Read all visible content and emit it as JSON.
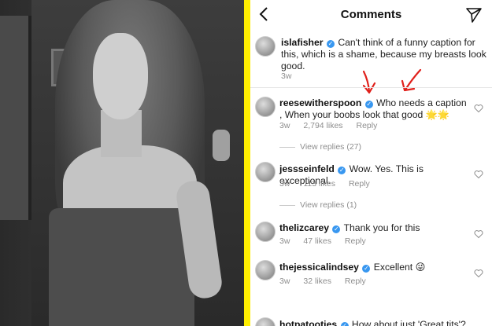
{
  "header": {
    "title": "Comments"
  },
  "caption": {
    "username": "islafisher",
    "text": "Can't think of a funny caption for this, which is a shame, because my breasts look good.",
    "time": "3w"
  },
  "comments": [
    {
      "username": "reesewitherspoon",
      "text": "Who needs a caption , When your boobs look that good",
      "emoji": "🌟🌟",
      "time": "3w",
      "likes": "2,794 likes",
      "reply_label": "Reply",
      "view_replies": "View replies (27)"
    },
    {
      "username": "jessseinfeld",
      "text": "Wow. Yes. This is exceptional.",
      "time": "3w",
      "likes": "113 likes",
      "reply_label": "Reply",
      "view_replies": "View replies (1)"
    },
    {
      "username": "thelizcarey",
      "text": "Thank you for this",
      "time": "3w",
      "likes": "47 likes",
      "reply_label": "Reply"
    },
    {
      "username": "thejessicalindsey",
      "text": "Excellent",
      "emoji": "😜",
      "time": "3w",
      "likes": "32 likes",
      "reply_label": "Reply"
    },
    {
      "username": "hotpatooties",
      "text": "How about just 'Great tits'?"
    }
  ],
  "colors": {
    "divider": "#ffee00",
    "verified": "#3897f0",
    "annotation": "#e0201b"
  },
  "icons": [
    "back-arrow-icon",
    "send-icon",
    "heart-icon",
    "verified-badge-icon"
  ]
}
